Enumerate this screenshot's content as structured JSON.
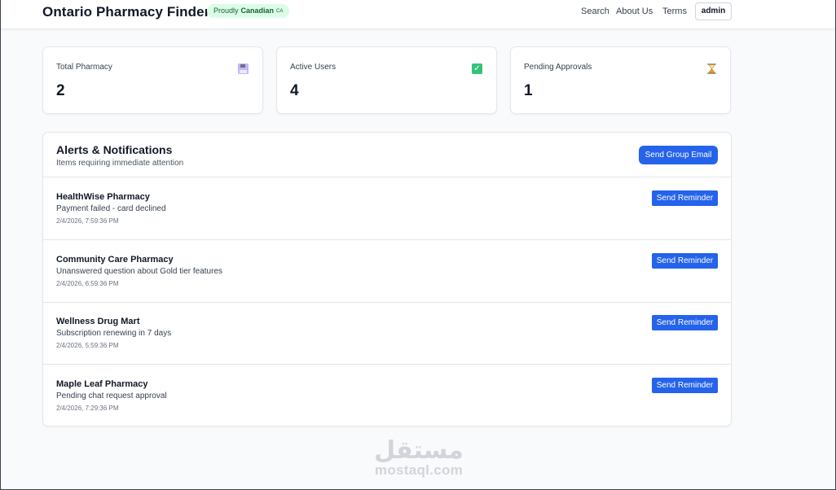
{
  "header": {
    "brand": "Ontario Pharmacy Finder",
    "badge": {
      "prefix": "Proudly",
      "strong": "Canadian",
      "suffix": "CA"
    },
    "nav": {
      "search": "Search",
      "about": "About Us",
      "terms": "Terms"
    },
    "user_button": "admin"
  },
  "stats": [
    {
      "label": "Total Pharmacy",
      "value": "2",
      "icon": "floppy-disk-icon"
    },
    {
      "label": "Active Users",
      "value": "4",
      "icon": "check-mark-icon"
    },
    {
      "label": "Pending Approvals",
      "value": "1",
      "icon": "hourglass-icon"
    }
  ],
  "alerts": {
    "title": "Alerts & Notifications",
    "subtitle": "Items requiring immediate attention",
    "group_button": "Send Group Email",
    "items": [
      {
        "name": "HealthWise Pharmacy",
        "message": "Payment failed - card declined",
        "time": "2/4/2026, 7:59:36 PM",
        "button": "Send Reminder"
      },
      {
        "name": "Community Care Pharmacy",
        "message": "Unanswered question about Gold tier features",
        "time": "2/4/2026, 6:59:36 PM",
        "button": "Send Reminder"
      },
      {
        "name": "Wellness Drug Mart",
        "message": "Subscription renewing in 7 days",
        "time": "2/4/2026, 5:59:36 PM",
        "button": "Send Reminder"
      },
      {
        "name": "Maple Leaf Pharmacy",
        "message": "Pending chat request approval",
        "time": "2/4/2026, 7:29:36 PM",
        "button": "Send Reminder"
      }
    ]
  },
  "watermark": {
    "logo_text": "مستقل",
    "text": "mostaql.com"
  },
  "colors": {
    "primary": "#2563eb",
    "badge_bg": "#dcfce7",
    "badge_text": "#166534",
    "page_bg": "#f9fafb"
  }
}
